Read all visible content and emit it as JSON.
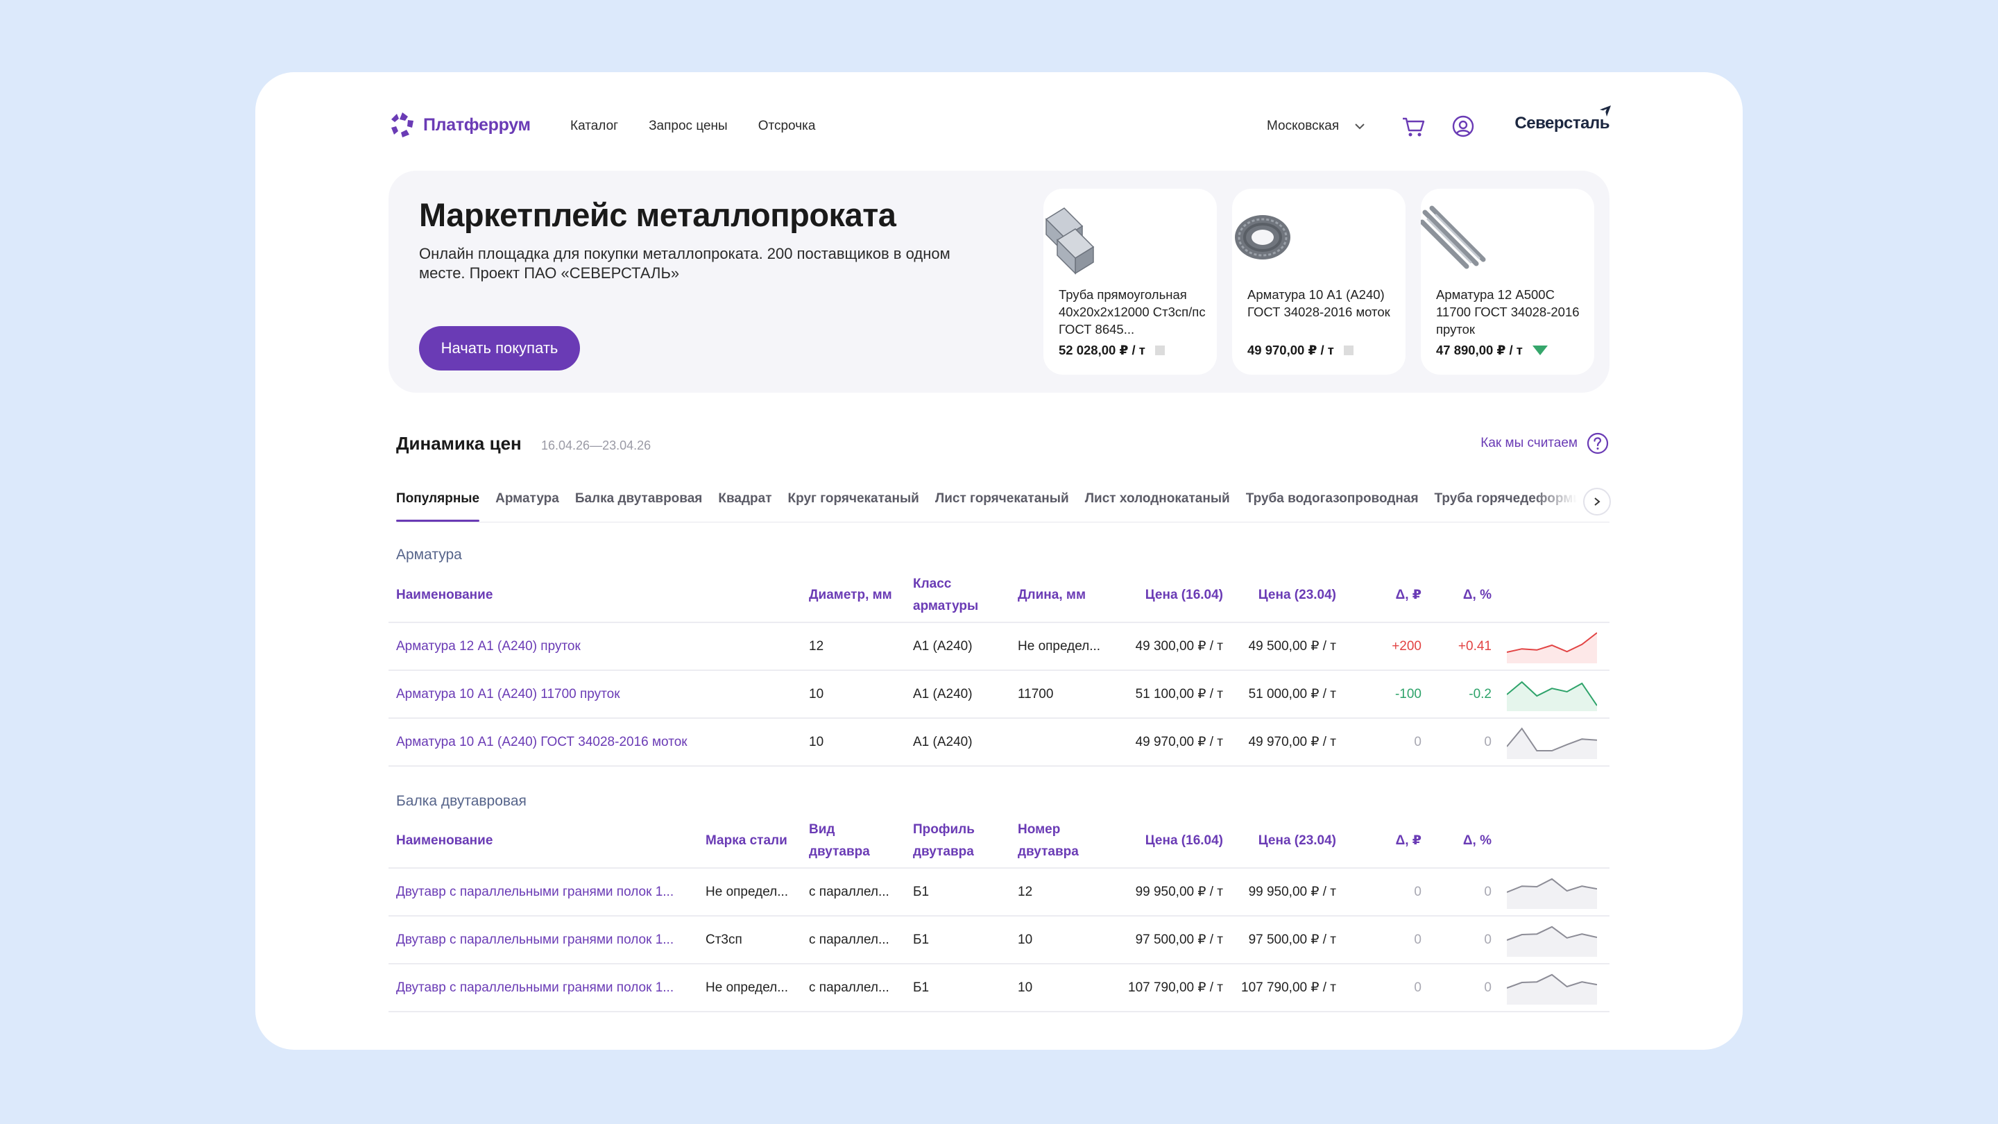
{
  "header": {
    "logo_text": "Платферрум",
    "nav": [
      "Каталог",
      "Запрос цены",
      "Отсрочка"
    ],
    "region": "Московская",
    "brand": "Северсталь"
  },
  "hero": {
    "title": "Маркетплейс металлопроката",
    "subtitle": "Онлайн площадка для покупки металлопроката. 200 поставщиков в одном месте. Проект ПАО «СЕВЕРСТАЛЬ»",
    "cta": "Начать покупать",
    "products": [
      {
        "name": "Труба прямоугольная 40х20х2х12000 Ст3сп/пс ГОСТ 8645...",
        "price": "52 028,00 ₽ / т",
        "trend": "flat",
        "image": "rect-tube-image"
      },
      {
        "name": "Арматура 10 А1 (А240) ГОСТ 34028-2016 моток",
        "price": "49 970,00 ₽ / т",
        "trend": "flat",
        "image": "rebar-coil-image"
      },
      {
        "name": "Арматура 12 А500С 11700 ГОСТ 34028-2016 пруток",
        "price": "47 890,00 ₽ / т",
        "trend": "down",
        "image": "rebar-bundle-image"
      }
    ]
  },
  "dynamics": {
    "title": "Динамика цен",
    "range": "16.04.26—23.04.26",
    "how_link": "Как мы считаем",
    "tabs": [
      "Популярные",
      "Арматура",
      "Балка двутавровая",
      "Квадрат",
      "Круг горячекатаный",
      "Лист горячекатаный",
      "Лист холоднокатаный",
      "Труба водогазопроводная",
      "Труба горячедеформированная"
    ],
    "active_tab": 0
  },
  "colors": {
    "accent": "#6a3bb5",
    "positive": "#e24444",
    "negative": "#2ea36a",
    "neutral": "#a8a8b2",
    "background": "#dce9fb"
  },
  "sections": [
    {
      "title": "Арматура",
      "headers": [
        "Наименование",
        "Диаметр, мм",
        "Класс арматуры",
        "Длина, мм",
        "Цена (16.04)",
        "Цена (23.04)",
        "Δ, ₽",
        "Δ, %"
      ],
      "rows": [
        {
          "cells": [
            "Арматура 12 А1 (А240) пруток",
            "12",
            "А1 (А240)",
            "Не определ...",
            "49 300,00 ₽ / т",
            "49 500,00 ₽ / т",
            "+200",
            "+0.41"
          ],
          "trend": "pos",
          "spark": [
            0.3,
            0.42,
            0.38,
            0.55,
            0.32,
            0.58,
            1.0
          ]
        },
        {
          "cells": [
            "Арматура 10 А1 (А240) 11700 пруток",
            "10",
            "А1 (А240)",
            "11700",
            "51 100,00 ₽ / т",
            "51 000,00 ₽ / т",
            "-100",
            "-0.2"
          ],
          "trend": "neg",
          "spark": [
            0.5,
            0.95,
            0.45,
            0.72,
            0.6,
            0.9,
            0.1
          ]
        },
        {
          "cells": [
            "Арматура 10 А1 (А240) ГОСТ 34028-2016 моток",
            "10",
            "А1 (А240)",
            "",
            "49 970,00 ₽ / т",
            "49 970,00 ₽ / т",
            "0",
            "0"
          ],
          "trend": "zero",
          "spark": [
            0.35,
            1.0,
            0.2,
            0.2,
            0.42,
            0.62,
            0.58
          ]
        }
      ]
    },
    {
      "title": "Балка двутавровая",
      "headers": [
        "Наименование",
        "Марка стали",
        "Вид двутавра",
        "Профиль двутавра",
        "Номер двутавра",
        "Цена (16.04)",
        "Цена (23.04)",
        "Δ, ₽",
        "Δ, %"
      ],
      "rows": [
        {
          "cells": [
            "Двутавр с параллельными гранями полок 1...",
            "Не определ...",
            "с параллел...",
            "Б1",
            "12",
            "99 950,00 ₽ / т",
            "99 950,00 ₽ / т",
            "0",
            "0"
          ],
          "trend": "zero",
          "spark": [
            0.5,
            0.72,
            0.7,
            0.98,
            0.55,
            0.72,
            0.62
          ]
        },
        {
          "cells": [
            "Двутавр с параллельными гранями полок 1...",
            "Ст3сп",
            "с параллел...",
            "Б1",
            "10",
            "97 500,00 ₽ / т",
            "97 500,00 ₽ / т",
            "0",
            "0"
          ],
          "trend": "zero",
          "spark": [
            0.5,
            0.7,
            0.72,
            0.98,
            0.58,
            0.72,
            0.6
          ]
        },
        {
          "cells": [
            "Двутавр с параллельными гранями полок 1...",
            "Не определ...",
            "с параллел...",
            "Б1",
            "10",
            "107 790,00 ₽ / т",
            "107 790,00 ₽ / т",
            "0",
            "0"
          ],
          "trend": "zero",
          "spark": [
            0.5,
            0.7,
            0.72,
            0.98,
            0.55,
            0.72,
            0.62
          ]
        }
      ]
    }
  ]
}
